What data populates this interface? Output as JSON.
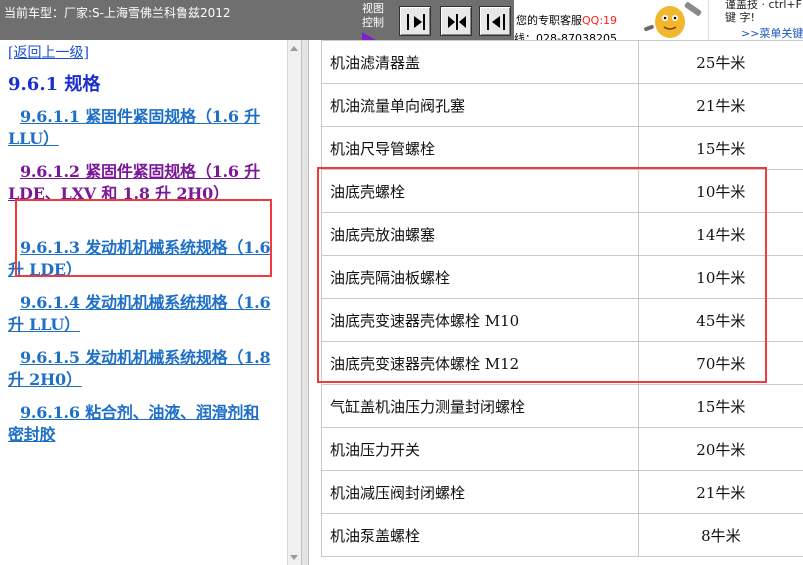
{
  "topbar": {
    "car_title": "当前车型：厂家:S-上海雪佛兰科鲁兹2012",
    "view_label_1": "视图",
    "view_label_2": "控制",
    "service_prefix": "您的专职客服",
    "service_qq": "QQ:19",
    "service_phone": "线：028-87038205",
    "promo_text": "谨盖技 · ctrl+F键 字!",
    "promo_link": ">>菜单关键"
  },
  "left": {
    "back_link": "[返回上一级]",
    "section_title": "9.6.1 规格",
    "toc": [
      {
        "label": "9.6.1.1 紧固件紧固规格（1.6 升 LLU）"
      },
      {
        "label": "9.6.1.2 紧固件紧固规格（1.6 升 LDE、LXV 和 1.8 升 2H0）"
      },
      {
        "label": "9.6.1.3 发动机机械系统规格（1.6 升 LDE）"
      },
      {
        "label": "9.6.1.4 发动机机械系统规格（1.6 升 LLU）"
      },
      {
        "label": "9.6.1.5 发动机机械系统规格（1.8 升 2H0）"
      },
      {
        "label": "9.6.1.6 粘合剂、油液、润滑剂和密封胶"
      }
    ]
  },
  "table": {
    "rows": [
      {
        "name": "机油滤清器盖",
        "value": "25牛米"
      },
      {
        "name": "机油流量单向阀孔塞",
        "value": "21牛米"
      },
      {
        "name": "机油尺导管螺栓",
        "value": "15牛米"
      },
      {
        "name": "油底壳螺栓",
        "value": "10牛米"
      },
      {
        "name": "油底壳放油螺塞",
        "value": "14牛米"
      },
      {
        "name": "油底壳隔油板螺栓",
        "value": "10牛米"
      },
      {
        "name": "油底壳变速器壳体螺栓 M10",
        "value": "45牛米"
      },
      {
        "name": "油底壳变速器壳体螺栓 M12",
        "value": "70牛米"
      },
      {
        "name": "气缸盖机油压力测量封闭螺栓",
        "value": "15牛米"
      },
      {
        "name": "机油压力开关",
        "value": "20牛米"
      },
      {
        "name": "机油减压阀封闭螺栓",
        "value": "21牛米"
      },
      {
        "name": "机油泵盖螺栓",
        "value": "8牛米"
      }
    ]
  },
  "colors": {
    "highlight_border": "#ef3b3b",
    "link_blue": "#1d6fc7",
    "visited_purple": "#7a1899",
    "topbar_bg": "#6f6f6f"
  },
  "icons": [
    "arrow-right-icon",
    "split-view-icon",
    "arrow-left-icon",
    "mascot-icon"
  ]
}
